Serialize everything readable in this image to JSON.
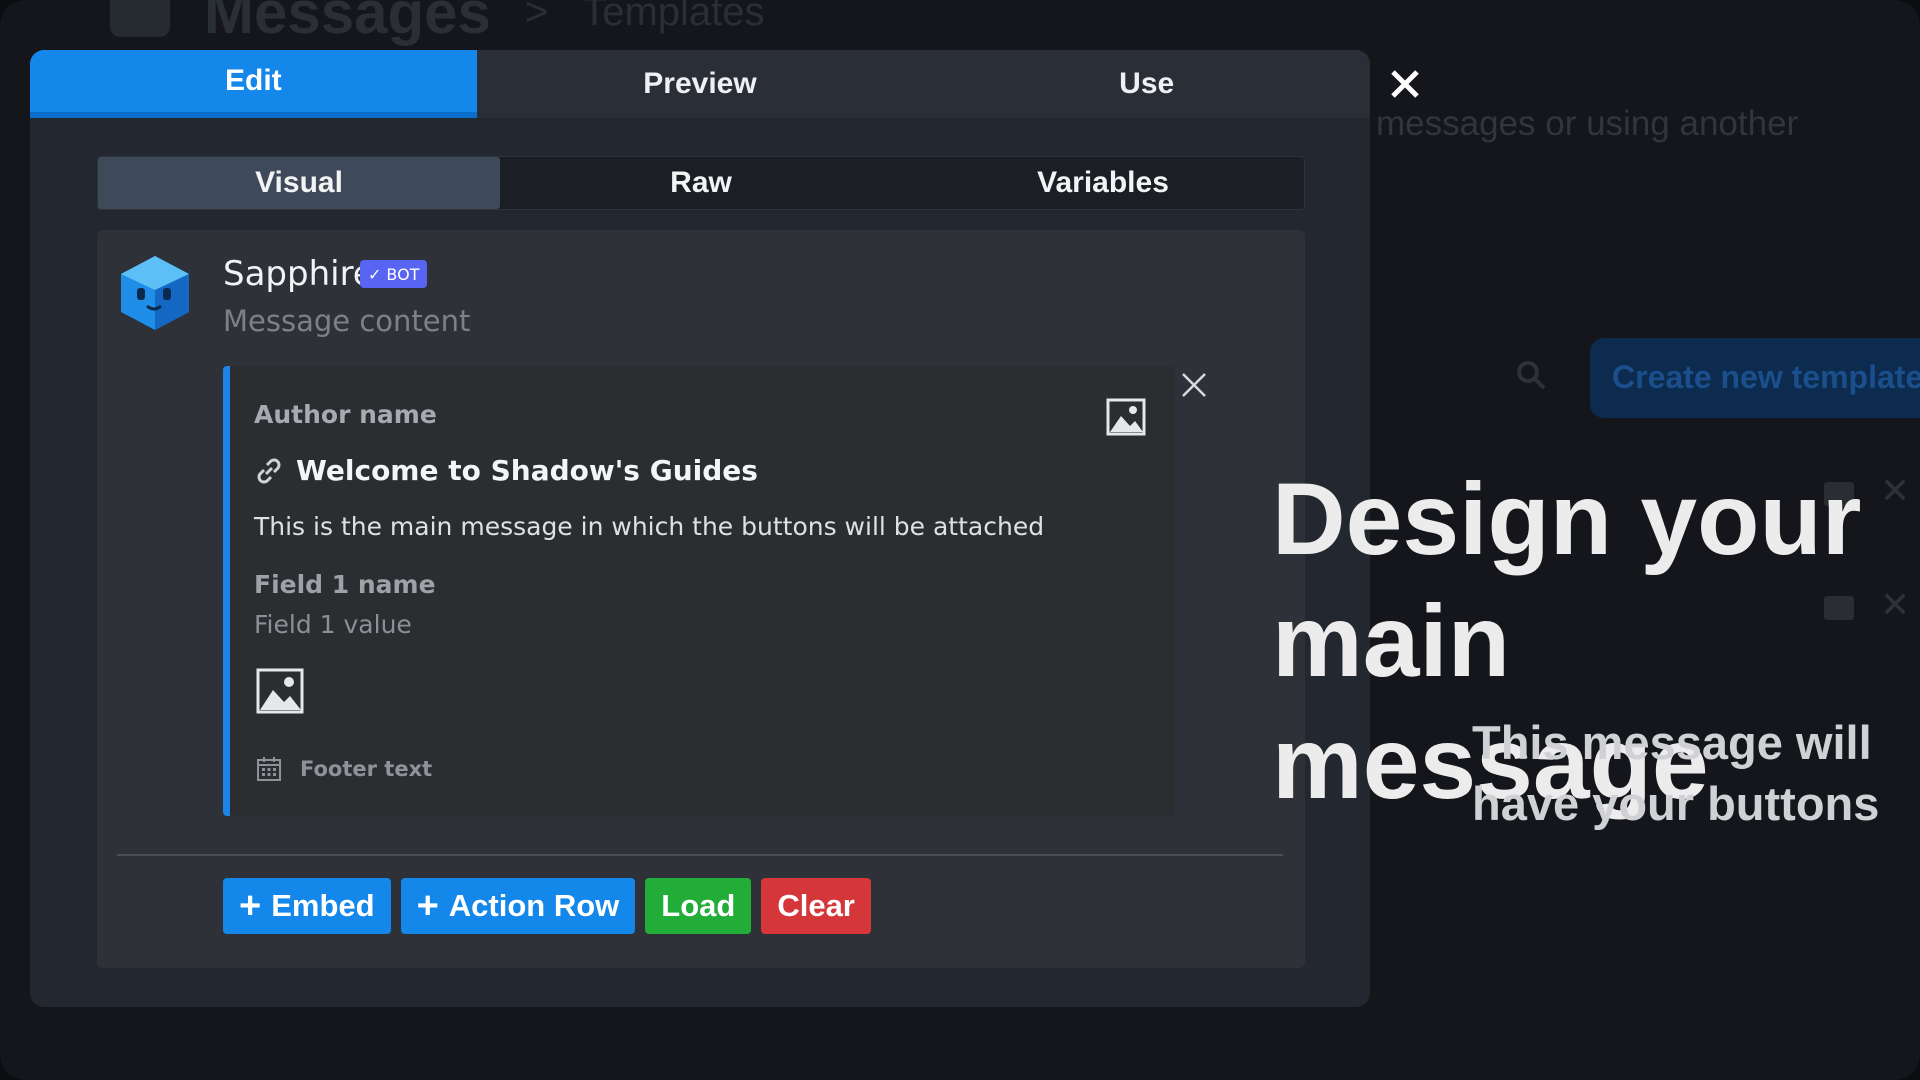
{
  "background": {
    "title": "Messages",
    "breadcrumb_separator": ">",
    "breadcrumb": "Templates",
    "description": "messages or using another",
    "create_button": "Create new template"
  },
  "modal": {
    "tabs": [
      {
        "label": "Edit",
        "active": true
      },
      {
        "label": "Preview",
        "active": false
      },
      {
        "label": "Use",
        "active": false
      }
    ],
    "subtabs": [
      {
        "label": "Visual",
        "active": true
      },
      {
        "label": "Raw",
        "active": false
      },
      {
        "label": "Variables",
        "active": false
      }
    ],
    "message": {
      "bot_name": "Sapphire",
      "bot_badge": "BOT",
      "content_placeholder": "Message content",
      "embed": {
        "accent_color": "#1c84e6",
        "author": "Author name",
        "title": "Welcome to Shadow's Guides",
        "description": "This is the main message in which the buttons will be attached",
        "field_name": "Field 1 name",
        "field_value": "Field 1 value",
        "footer": "Footer text"
      }
    },
    "actions": {
      "embed": "Embed",
      "action_row": "Action Row",
      "load": "Load",
      "clear": "Clear"
    }
  },
  "promo": {
    "title": "Design your main message",
    "subtitle": "This message will have your buttons"
  },
  "colors": {
    "primary": "#1487ea",
    "success": "#22ad38",
    "danger": "#d4363a",
    "badge": "#5865f2"
  }
}
